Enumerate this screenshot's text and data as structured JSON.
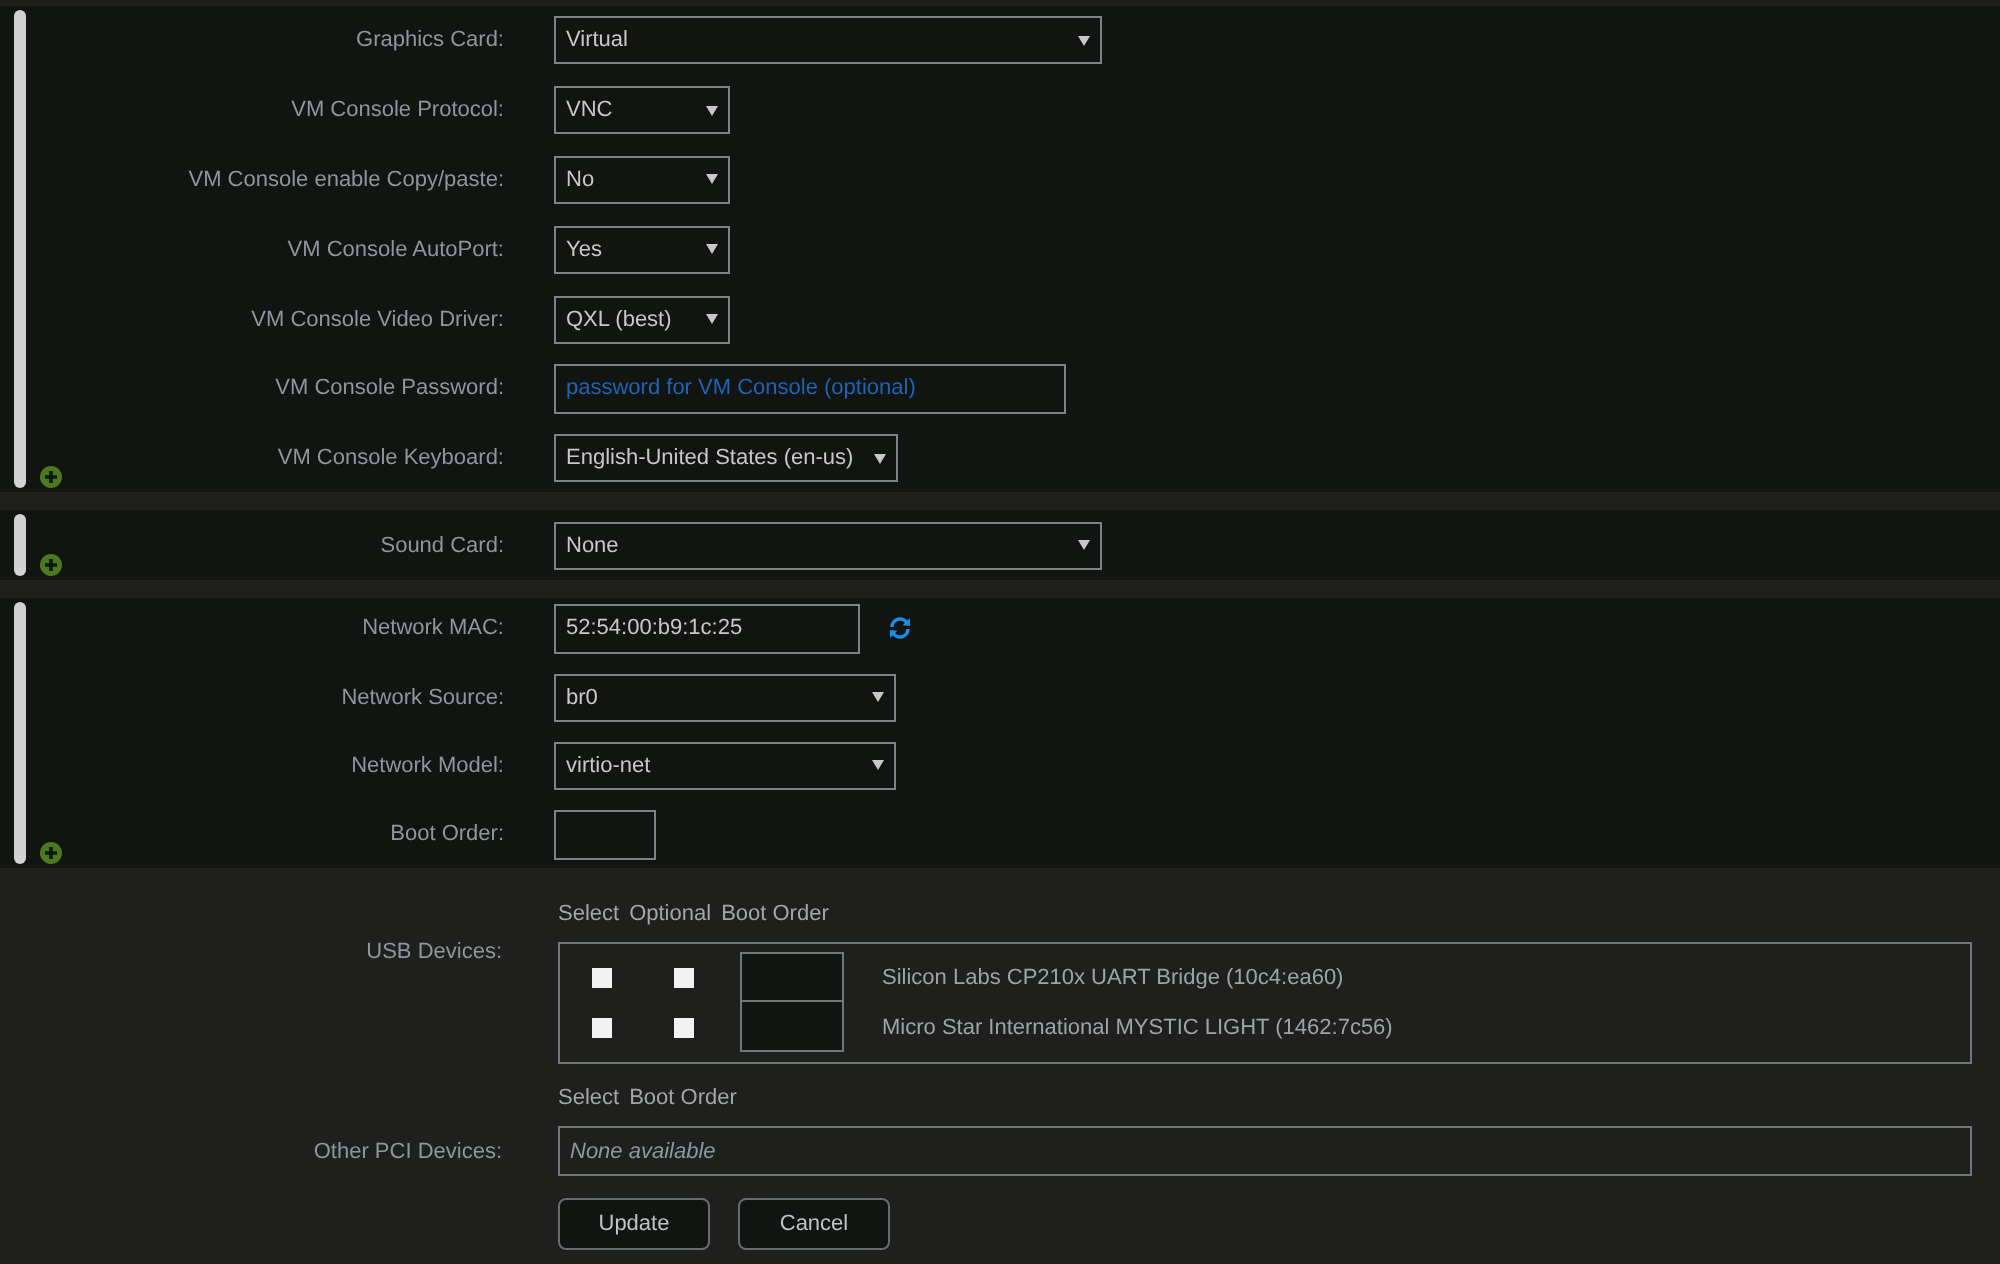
{
  "sections": [
    {
      "fields": [
        {
          "kind": "select",
          "label": "Graphics Card:",
          "value": "Virtual"
        },
        {
          "kind": "select",
          "label": "VM Console Protocol:",
          "value": "VNC"
        },
        {
          "kind": "select",
          "label": "VM Console enable Copy/paste:",
          "value": "No"
        },
        {
          "kind": "select",
          "label": "VM Console AutoPort:",
          "value": "Yes"
        },
        {
          "kind": "select",
          "label": "VM Console Video Driver:",
          "value": "QXL (best)"
        },
        {
          "kind": "password",
          "label": "VM Console Password:",
          "placeholder": "password for VM Console (optional)"
        },
        {
          "kind": "select",
          "label": "VM Console Keyboard:",
          "value": "English-United States (en-us)"
        }
      ]
    },
    {
      "fields": [
        {
          "kind": "select",
          "label": "Sound Card:",
          "value": "None"
        }
      ]
    },
    {
      "fields": [
        {
          "kind": "mac",
          "label": "Network MAC:",
          "value": "52:54:00:b9:1c:25"
        },
        {
          "kind": "select",
          "label": "Network Source:",
          "value": "br0"
        },
        {
          "kind": "select",
          "label": "Network Model:",
          "value": "virtio-net"
        },
        {
          "kind": "number",
          "label": "Boot Order:"
        }
      ]
    }
  ],
  "usb_devices": {
    "columns": [
      "Select",
      "Optional",
      "Boot Order"
    ],
    "label": "USB Devices:",
    "devices": [
      {
        "name": "Silicon Labs CP210x UART Bridge (10c4:ea60)",
        "select_checked": false,
        "optional_checked": false
      },
      {
        "name": "Micro Star International MYSTIC LIGHT (1462:7c56)",
        "select_checked": false,
        "optional_checked": false
      }
    ]
  },
  "pci_devices": {
    "columns": [
      "Select",
      "Boot Order"
    ],
    "label": "Other PCI Devices:",
    "note": "None available"
  },
  "buttons": [
    "Update",
    "Cancel"
  ]
}
